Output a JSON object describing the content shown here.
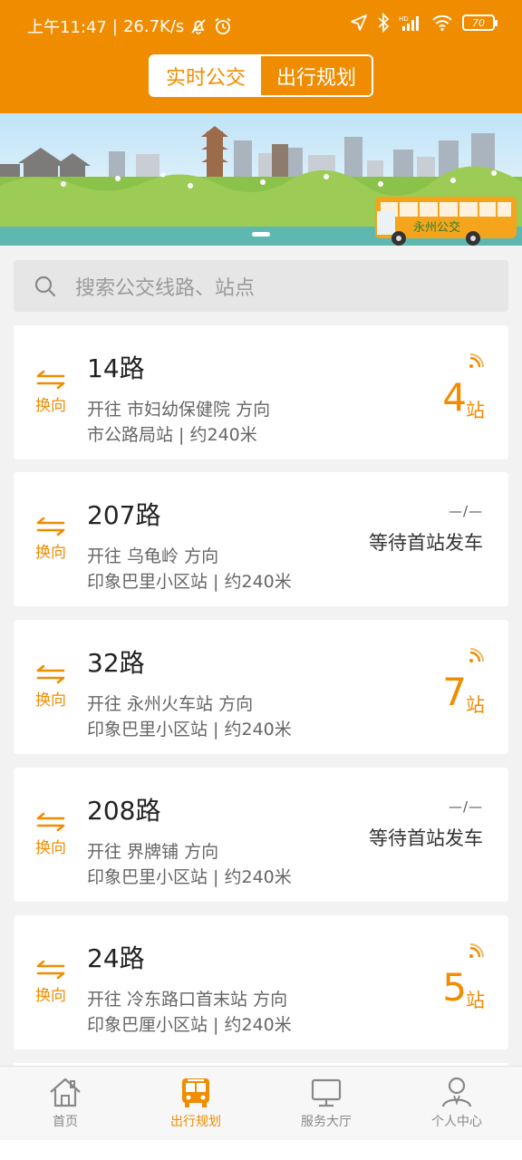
{
  "status": {
    "time": "上午11:47",
    "speed": "26.7K/s",
    "battery": "70",
    "colors": {
      "text": "#ffffff"
    }
  },
  "header": {
    "tabs": [
      {
        "label": "实时公交",
        "active": true
      },
      {
        "label": "出行规划",
        "active": false
      }
    ],
    "accent": "#f08c00"
  },
  "banner": {
    "bus_text": "永州公交"
  },
  "search": {
    "placeholder": "搜索公交线路、站点"
  },
  "swap_label": "换向",
  "routes": [
    {
      "name": "14路",
      "direction": "开往 市妇幼保健院 方向",
      "stop": "市公路局站 | 约240米",
      "stations": "4",
      "unit": "站",
      "status": "arriving"
    },
    {
      "name": "207路",
      "direction": "开往 乌龟岭 方向",
      "stop": "印象巴里小区站 | 约240米",
      "dash": "—/—",
      "waiting": "等待首站发车",
      "status": "waiting"
    },
    {
      "name": "32路",
      "direction": "开往 永州火车站 方向",
      "stop": "印象巴里小区站 | 约240米",
      "stations": "7",
      "unit": "站",
      "status": "arriving"
    },
    {
      "name": "208路",
      "direction": "开往 界牌铺 方向",
      "stop": "印象巴里小区站 | 约240米",
      "dash": "—/—",
      "waiting": "等待首站发车",
      "status": "waiting"
    },
    {
      "name": "24路",
      "direction": "开往 冷东路口首末站 方向",
      "stop": "印象巴厘小区站 | 约240米",
      "stations": "5",
      "unit": "站",
      "status": "arriving"
    }
  ],
  "tabbar": [
    {
      "label": "首页",
      "icon": "home-icon",
      "active": false
    },
    {
      "label": "出行规划",
      "icon": "bus-icon",
      "active": true
    },
    {
      "label": "服务大厅",
      "icon": "monitor-icon",
      "active": false
    },
    {
      "label": "个人中心",
      "icon": "person-icon",
      "active": false
    }
  ]
}
